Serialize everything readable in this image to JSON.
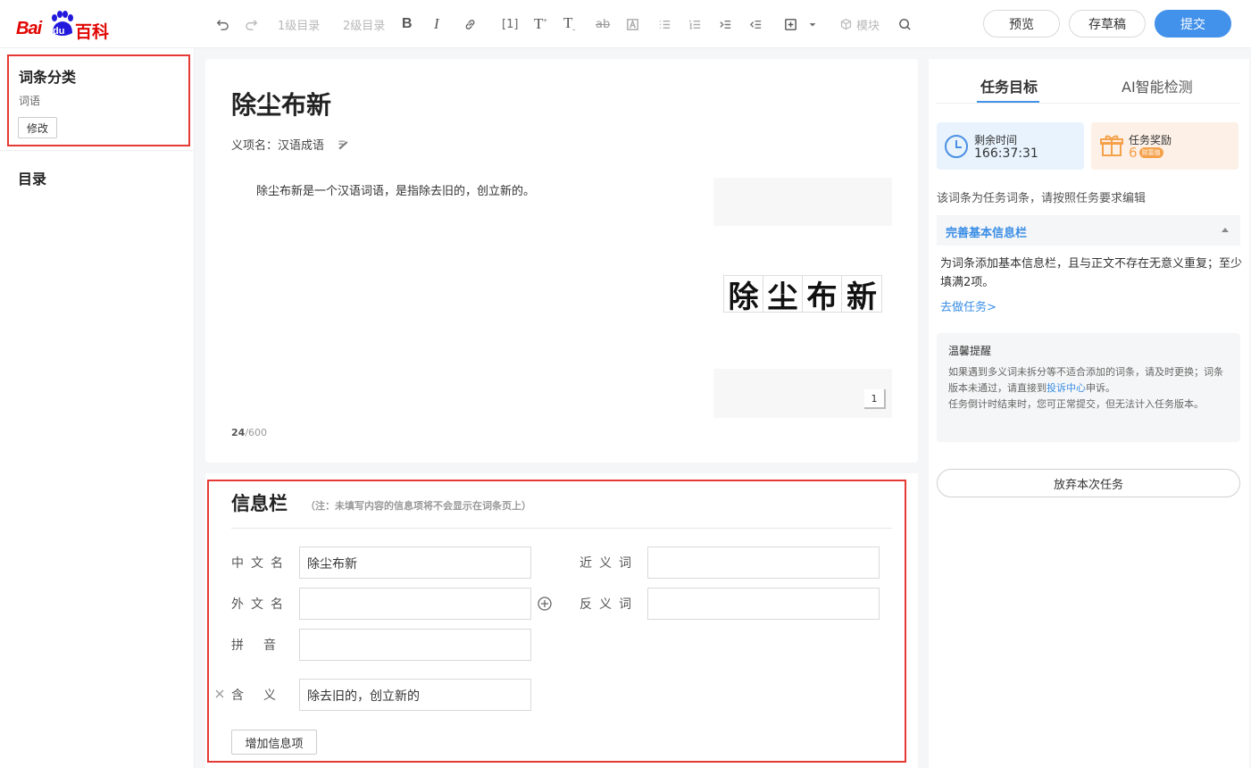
{
  "brand": {
    "logo_latin": "Bai",
    "logo_du": "du",
    "logo_cn": "百科"
  },
  "toolbar": {
    "heading1": "1级目录",
    "heading2": "2级目录",
    "module": "模块"
  },
  "header_buttons": {
    "preview": "预览",
    "save_draft": "存草稿",
    "submit": "提交"
  },
  "sidebar": {
    "category_title": "词条分类",
    "category_value": "词语",
    "edit_button": "修改",
    "toc_title": "目录"
  },
  "editor": {
    "title": "除尘布新",
    "sense_label": "义项名：",
    "sense_value": "汉语成语",
    "body_text": "除尘布新是一个汉语词语，是指除去旧的，创立新的。",
    "image_caption_chars": "除尘布新",
    "image_count": "1",
    "char_count": "24",
    "char_limit": "/600"
  },
  "infobox": {
    "title": "信息栏",
    "note": "（注：未填写内容的信息项将不会显示在词条页上）",
    "fields": {
      "chinese_name_label": "中文名",
      "chinese_name_value": "除尘布新",
      "foreign_name_label": "外文名",
      "foreign_name_value": "",
      "pinyin_label": "拼音",
      "pinyin_value": "",
      "meaning_label": "含义",
      "meaning_value": "除去旧的，创立新的",
      "synonym_label": "近义词",
      "synonym_value": "",
      "antonym_label": "反义词",
      "antonym_value": ""
    },
    "add_item_button": "增加信息项"
  },
  "right_panel": {
    "tabs": [
      "任务目标",
      "AI智能检测"
    ],
    "active_tab": 0,
    "time_label": "剩余时间",
    "time_value": "166:37:31",
    "reward_label": "任务奖励",
    "reward_value": "6",
    "reward_badge": "财富值",
    "task_notice": "该词条为任务词条，请按照任务要求编辑",
    "task_section_title": "完善基本信息栏",
    "task_desc": "为词条添加基本信息栏，且与正文不存在无意义重复；至少填满2项。",
    "task_link": "去做任务>",
    "tip_title": "温馨提醒",
    "tip_text_1": "如果遇到多义词未拆分等不适合添加的词条，请及时更换；词条版本未通过，请直接到",
    "tip_link": "投诉中心",
    "tip_text_1b": "申诉。",
    "tip_text_2": "任务倒计时结束时，您可正常提交，但无法计入任务版本。",
    "abandon_button": "放弃本次任务"
  },
  "colors": {
    "brand_red": "#e10602",
    "accent_blue": "#4291ea",
    "box_red": "#e53935"
  }
}
